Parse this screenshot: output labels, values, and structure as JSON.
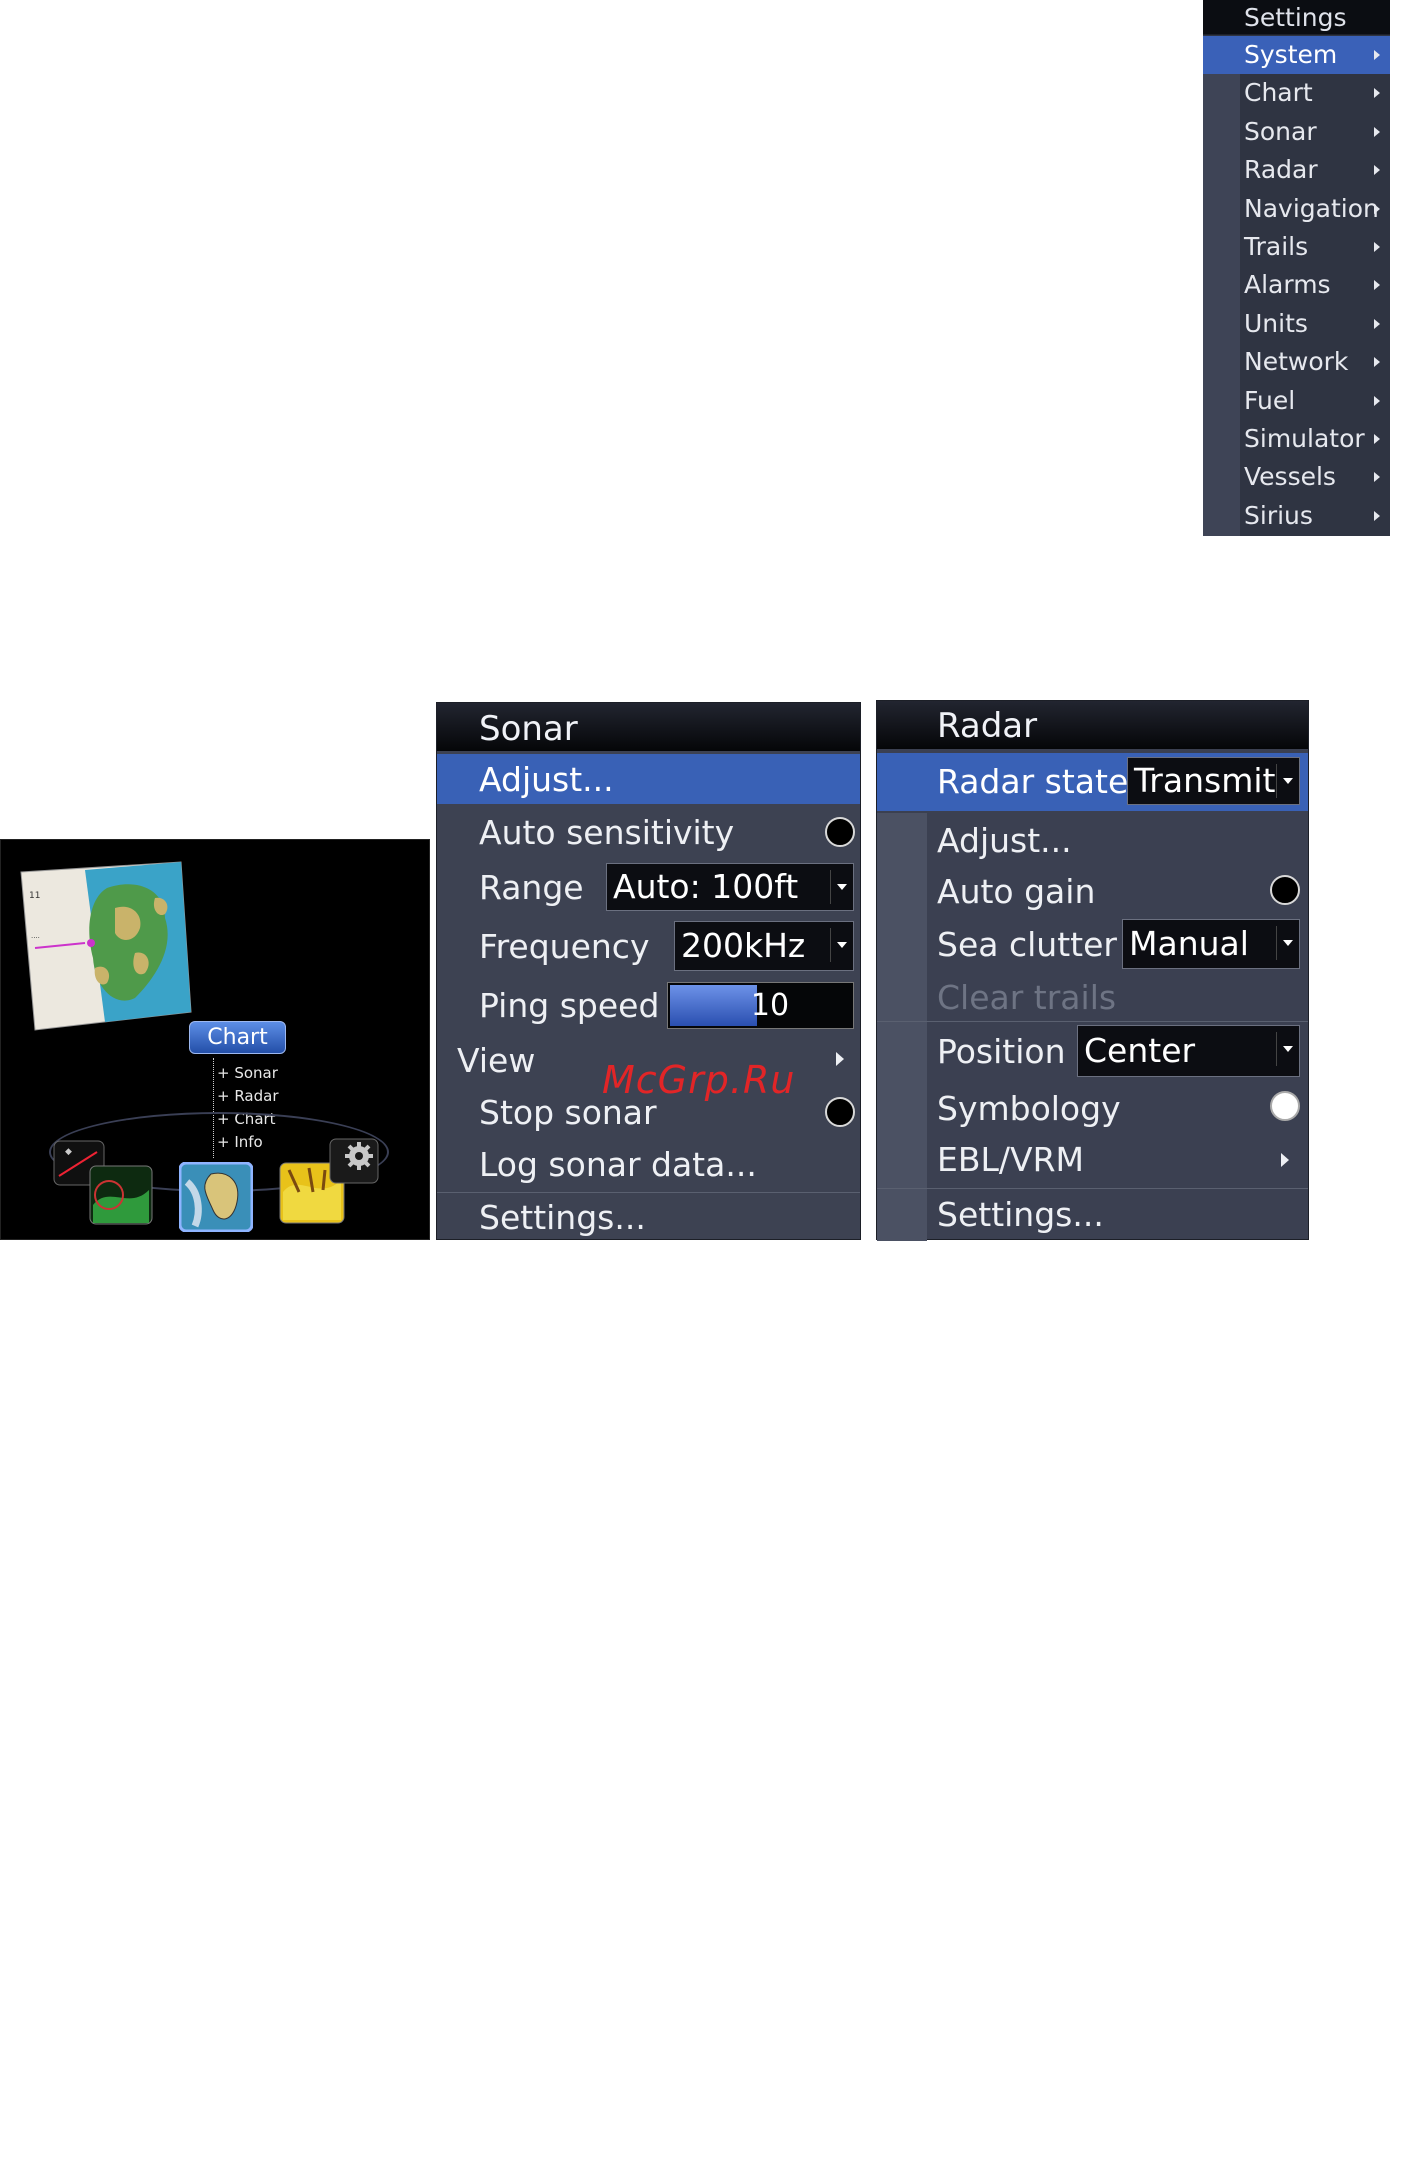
{
  "settings_menu": {
    "title": "Settings",
    "items": [
      {
        "label": "System",
        "selected": true
      },
      {
        "label": "Chart"
      },
      {
        "label": "Sonar"
      },
      {
        "label": "Radar"
      },
      {
        "label": "Navigation"
      },
      {
        "label": "Trails"
      },
      {
        "label": "Alarms"
      },
      {
        "label": "Units"
      },
      {
        "label": "Network"
      },
      {
        "label": "Fuel"
      },
      {
        "label": "Simulator"
      },
      {
        "label": "Vessels"
      },
      {
        "label": "Sirius"
      }
    ]
  },
  "home_screen": {
    "active_app": "Chart",
    "sub_options": [
      "+ Sonar",
      "+ Radar",
      "+ Chart",
      "+ Info"
    ],
    "icons": [
      "radar-app-icon",
      "sonar-app-icon",
      "chart-app-icon",
      "structure-app-icon",
      "settings-gear-icon"
    ]
  },
  "sonar_menu": {
    "title": "Sonar",
    "adjust": "Adjust...",
    "auto_sensitivity": "Auto sensitivity",
    "range_label": "Range",
    "range_value": "Auto: 100ft",
    "frequency_label": "Frequency",
    "frequency_value": "200kHz",
    "ping_speed_label": "Ping speed",
    "ping_speed_value": "10",
    "ping_speed_fraction": 0.48,
    "view": "View",
    "stop_sonar": "Stop sonar",
    "log_sonar": "Log sonar data...",
    "settings": "Settings..."
  },
  "radar_menu": {
    "title": "Radar",
    "radar_state_label": "Radar state",
    "radar_state_value": "Transmit",
    "adjust": "Adjust...",
    "auto_gain": "Auto gain",
    "sea_clutter_label": "Sea clutter",
    "sea_clutter_value": "Manual",
    "clear_trails": "Clear trails",
    "position_label": "Position",
    "position_value": "Center",
    "symbology": "Symbology",
    "ebl_vrm": "EBL/VRM",
    "settings": "Settings..."
  },
  "watermark": "McGrp.Ru",
  "colors": {
    "highlight": "#3a61b8",
    "menu_bg": "#3d4252",
    "title_bg": "#050608"
  }
}
